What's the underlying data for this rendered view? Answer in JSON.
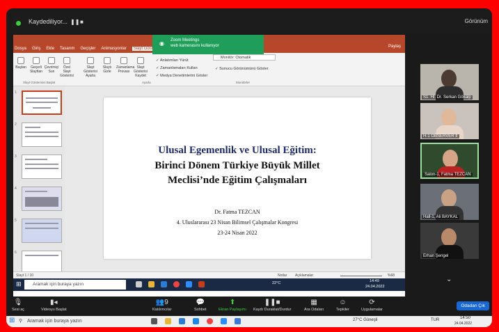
{
  "zoom_top": {
    "recording": "Kaydediliyor...",
    "pause": "❚❚",
    "stop": "■",
    "gallery": "Görünüm"
  },
  "ppt": {
    "tabs": [
      "Dosya",
      "Giriş",
      "Ekle",
      "Tasarım",
      "Geçişler",
      "Animasyonlar",
      "Slayt Gösterisi"
    ],
    "share": "Paylaş",
    "ribbon": {
      "items": [
        "Baştan",
        "Geçerli Slayttan",
        "Çevrimiçi Sun",
        "Özel Slayt Gösterisi",
        "Slayt Gösterisi Ayarla",
        "Slaytı Gizle",
        "Zamanlama Provası",
        "Slayt Gösterisi Kaydet"
      ],
      "checks": [
        "Anlatımları Yürüt",
        "Zamanlamaları Kullan",
        "Medya Denetimlerini Göster"
      ],
      "monitor": "Monitör: Otomatik",
      "presenter": "Sunucu Görünümünü Göster",
      "groups": [
        "Slayt Gösterisini Başlat",
        "Ayarla",
        "Monitörler"
      ]
    },
    "toast": {
      "line1": "Zoom Meetings",
      "line2": "web kamerasını kullanıyor"
    },
    "slide": {
      "title": "Ulusal Egemenlik ve Ulusal Eğitim:",
      "sub1": "Birinci Dönem Türkiye Büyük Millet",
      "sub2": "Meclisi’nde Eğitim Çalışmaları",
      "author": "Dr. Fatma TEZCAN",
      "congress": "4. Uluslararası 23 Nisan Bilimsel Çalışmalar Kongresi",
      "date": "23-24 Nisan 2022"
    },
    "status": {
      "slide": "Slayt 1 / 10",
      "notes": "Notlar",
      "comments": "Açıklamalar",
      "zoom": "%68"
    },
    "taskbar": {
      "search": "Aramak için buraya yazın",
      "temp": "22°C",
      "time": "14:49",
      "date": "24.04.2022"
    }
  },
  "participants": [
    {
      "name": "S1. Hl. Dr. Serkan Gökalp"
    },
    {
      "name": "H-1 OBSERVER II"
    },
    {
      "name": "Salon-1, Fatma TEZCAN"
    },
    {
      "name": "Hall-1, Ali BAYKAL"
    },
    {
      "name": "Erhan Şengel"
    }
  ],
  "zoom_bar": {
    "mute": "Sesi aç",
    "video": "Videoyu Başlat",
    "participants": "Katılımcılar",
    "participants_count": "9",
    "chat": "Sohbet",
    "share": "Ekran Paylaşımı",
    "record": "Kaydı Duraklat/Durdur",
    "breakout": "Ara Odaları",
    "reactions": "Tepkiler",
    "apps": "Uygulamalar",
    "end": "Odadan Çık"
  },
  "win_bar": {
    "search": "Aramak için buraya yazın",
    "weather": "27°C Güneşli",
    "lang": "TUR",
    "time": "14:50",
    "date": "24.04.2022"
  }
}
